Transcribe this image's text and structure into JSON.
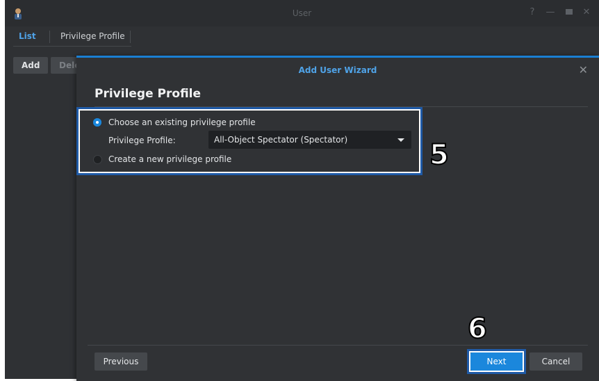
{
  "window": {
    "title": "User",
    "controls": [
      "help-icon",
      "minimize-icon",
      "maximize-icon",
      "close-icon"
    ],
    "tabs": [
      {
        "label": "List",
        "active": true
      },
      {
        "label": "Privilege Profile",
        "active": false
      }
    ],
    "toolbar": {
      "add_label": "Add",
      "delete_label": "Dele"
    }
  },
  "wizard": {
    "title": "Add User Wizard",
    "section_title": "Privilege Profile",
    "options": [
      {
        "label": "Choose an existing privilege profile",
        "selected": true
      },
      {
        "label": "Create a new privilege profile",
        "selected": false
      }
    ],
    "profile_field": {
      "label": "Privilege Profile:",
      "value": "All-Object Spectator (Spectator)"
    },
    "footer": {
      "previous_label": "Previous",
      "next_label": "Next",
      "cancel_label": "Cancel"
    }
  },
  "annotations": {
    "step5": "5",
    "step6": "6"
  },
  "colors": {
    "accent": "#1b87dc",
    "title_accent": "#4fa3e8",
    "callout": "#1f5aa6"
  }
}
